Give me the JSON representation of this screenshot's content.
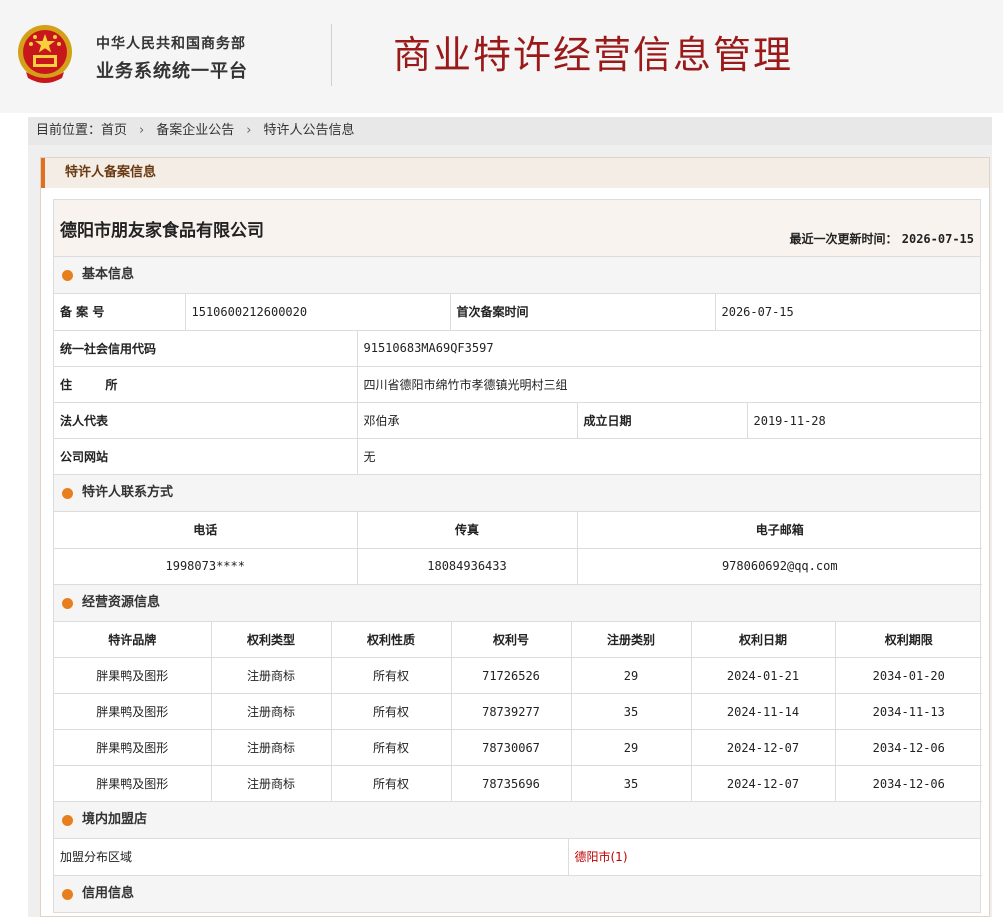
{
  "header": {
    "org_line1": "中华人民共和国商务部",
    "org_line2": "业务系统统一平台",
    "system_title": "商业特许经营信息管理"
  },
  "breadcrumb": {
    "prefix": "目前位置：",
    "items": [
      "首页",
      "备案企业公告",
      "特许人公告信息"
    ],
    "separator": "›"
  },
  "panel": {
    "title": "特许人备案信息"
  },
  "company": {
    "name": "德阳市朋友家食品有限公司",
    "update_label": "最近一次更新时间：",
    "update_date": "2026-07-15"
  },
  "basic": {
    "title": "基本信息",
    "record_no_label": "备  案  号",
    "record_no": "1510600212600020",
    "first_record_label": "首次备案时间",
    "first_record_date": "2026-07-15",
    "credit_code_label": "统一社会信用代码",
    "credit_code": "91510683MA69QF3597",
    "address_label": "住        所",
    "address": "四川省德阳市绵竹市孝德镇光明村三组",
    "legal_rep_label": "法人代表",
    "legal_rep": "邓伯承",
    "founded_label": "成立日期",
    "founded_date": "2019-11-28",
    "website_label": "公司网站",
    "website": "无"
  },
  "contact": {
    "title": "特许人联系方式",
    "headers": [
      "电话",
      "传真",
      "电子邮箱"
    ],
    "values": [
      "1998073****",
      "18084936433",
      "978060692@qq.com"
    ]
  },
  "resources": {
    "title": "经营资源信息",
    "headers": [
      "特许品牌",
      "权利类型",
      "权利性质",
      "权利号",
      "注册类别",
      "权利日期",
      "权利期限"
    ],
    "rows": [
      [
        "胖果鸭及图形",
        "注册商标",
        "所有权",
        "71726526",
        "29",
        "2024-01-21",
        "2034-01-20"
      ],
      [
        "胖果鸭及图形",
        "注册商标",
        "所有权",
        "78739277",
        "35",
        "2024-11-14",
        "2034-11-13"
      ],
      [
        "胖果鸭及图形",
        "注册商标",
        "所有权",
        "78730067",
        "29",
        "2024-12-07",
        "2034-12-06"
      ],
      [
        "胖果鸭及图形",
        "注册商标",
        "所有权",
        "78735696",
        "35",
        "2024-12-07",
        "2034-12-06"
      ]
    ]
  },
  "stores": {
    "title": "境内加盟店",
    "region_label": "加盟分布区域",
    "region_value": "德阳市(1)"
  },
  "credit": {
    "title": "信用信息"
  },
  "colors": {
    "brand_red": "#9a1a1a",
    "accent_orange": "#e87f1e",
    "link_red": "#c00000"
  }
}
